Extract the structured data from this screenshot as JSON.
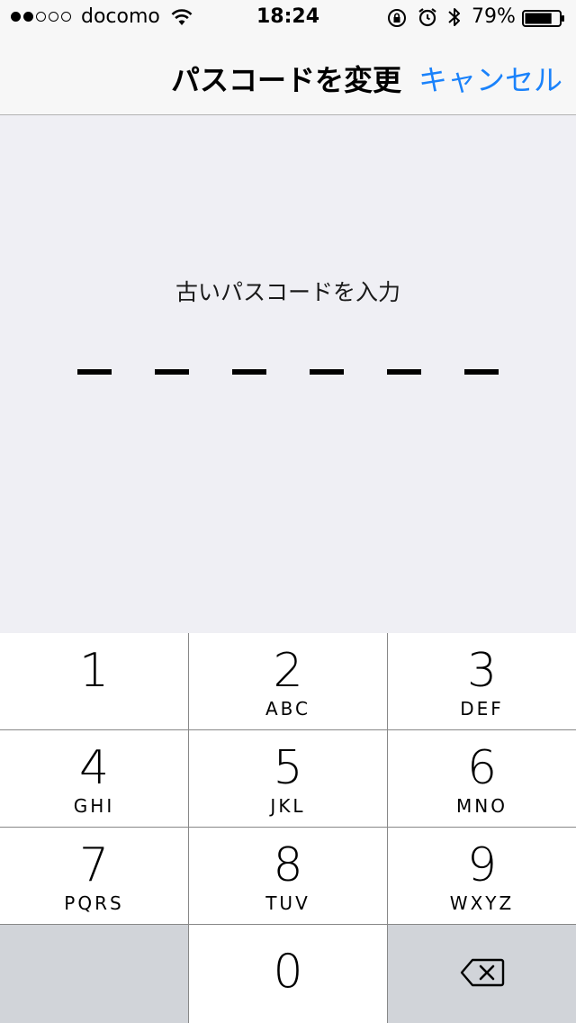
{
  "status_bar": {
    "carrier": "docomo",
    "time": "18:24",
    "battery_percent": "79%",
    "battery_level": 0.79,
    "signal_bars_filled": 2,
    "signal_bars_total": 5,
    "icons": [
      "wifi-icon",
      "rotation-lock-icon",
      "alarm-icon",
      "bluetooth-icon",
      "battery-icon"
    ]
  },
  "nav": {
    "title": "パスコードを変更",
    "cancel_label": "キャンセル"
  },
  "prompt": {
    "label": "古いパスコードを入力",
    "digits_total": 6,
    "digits_entered": 0
  },
  "keypad": {
    "keys": [
      {
        "digit": "1",
        "letters": ""
      },
      {
        "digit": "2",
        "letters": "ABC"
      },
      {
        "digit": "3",
        "letters": "DEF"
      },
      {
        "digit": "4",
        "letters": "GHI"
      },
      {
        "digit": "5",
        "letters": "JKL"
      },
      {
        "digit": "6",
        "letters": "MNO"
      },
      {
        "digit": "7",
        "letters": "PQRS"
      },
      {
        "digit": "8",
        "letters": "TUV"
      },
      {
        "digit": "9",
        "letters": "WXYZ"
      },
      {
        "digit": "0",
        "letters": ""
      }
    ],
    "delete_icon": "delete-backspace-icon"
  },
  "colors": {
    "accent": "#1a82fb",
    "background": "#efeff4",
    "keypad_dark": "#d1d4d9"
  }
}
